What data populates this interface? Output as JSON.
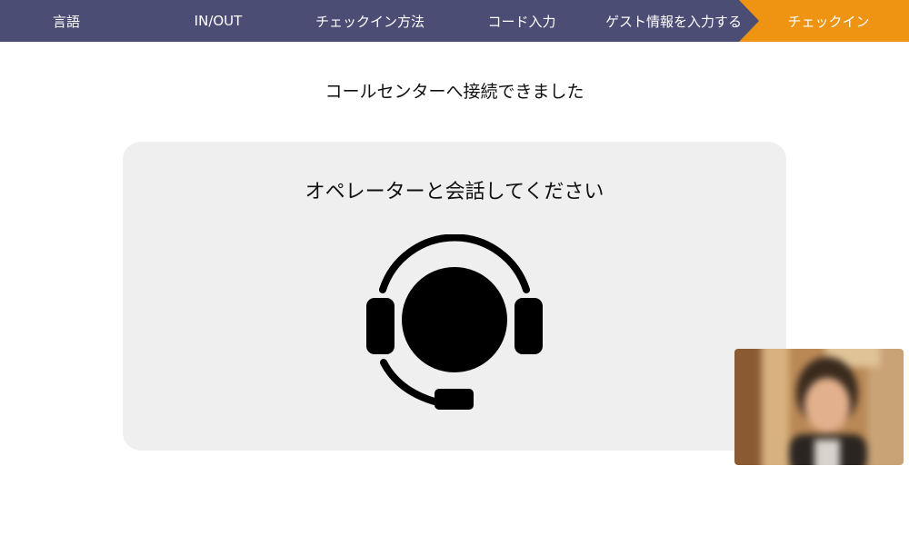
{
  "stepper": {
    "colors": {
      "inactive": "#4c4d74",
      "active": "#ee9312"
    },
    "steps": [
      {
        "label": "言語",
        "state": "completed"
      },
      {
        "label": "IN/OUT",
        "state": "completed"
      },
      {
        "label": "チェックイン方法",
        "state": "completed"
      },
      {
        "label": "コード入力",
        "state": "completed"
      },
      {
        "label": "ゲスト情報を入力する",
        "state": "completed"
      },
      {
        "label": "チェックイン",
        "state": "current"
      }
    ]
  },
  "status": {
    "message": "コールセンターへ接続できました"
  },
  "operator_card": {
    "title": "オペレーターと会話してください",
    "icon": "headset-operator-icon",
    "background": "#efefef"
  },
  "video_preview": {
    "icon": "operator-video-feed"
  }
}
